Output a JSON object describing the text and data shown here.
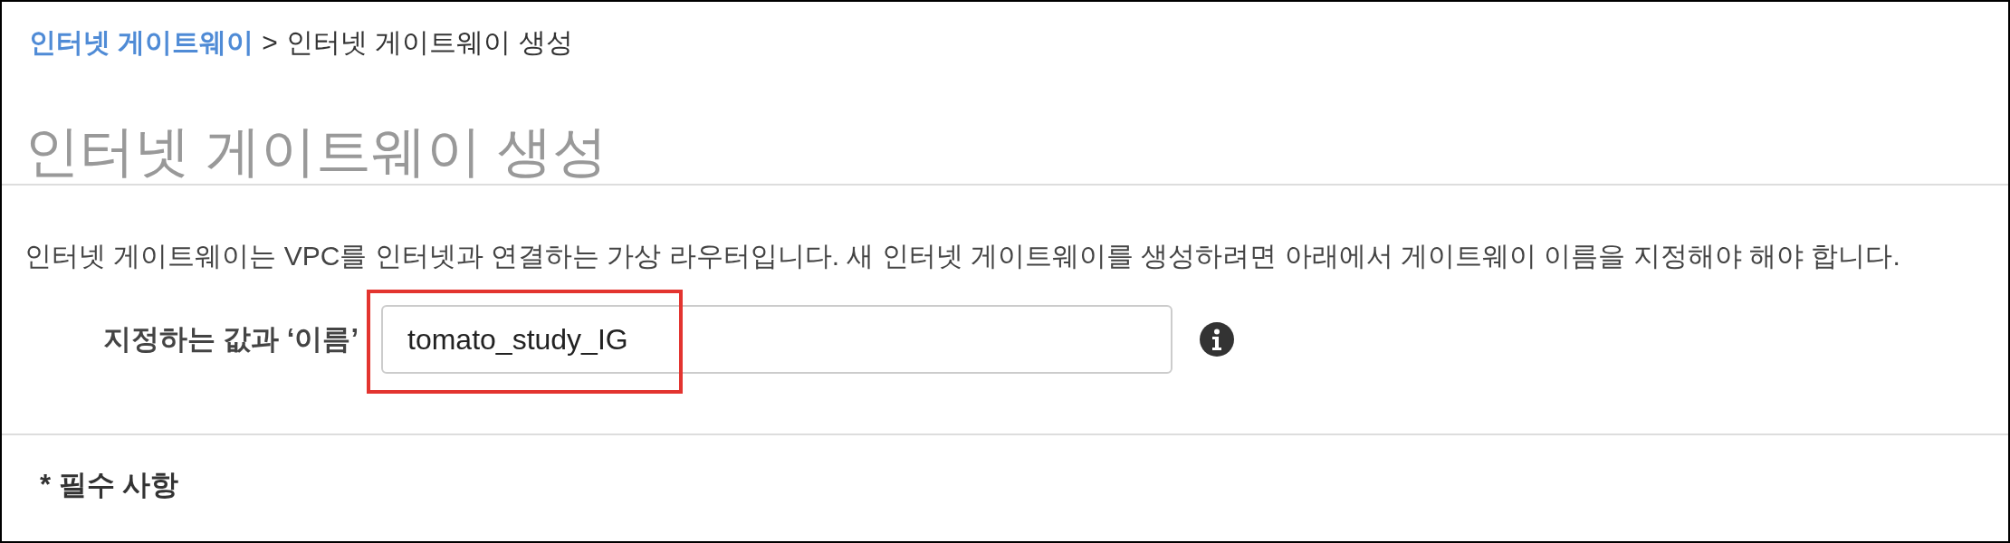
{
  "breadcrumb": {
    "separator": ">",
    "items": [
      {
        "label": "인터넷 게이트웨이",
        "kind": "link"
      },
      {
        "label": "인터넷 게이트웨이 생성",
        "kind": "current"
      }
    ]
  },
  "title": "인터넷 게이트웨이 생성",
  "description": "인터넷 게이트웨이는 VPC를 인터넷과 연결하는 가상 라우터입니다. 새 인터넷 게이트웨이를 생성하려면 아래에서 게이트웨이 이름을 지정해야 해야 합니다.",
  "form": {
    "fields": [
      {
        "label": "지정하는 값과 ‘이름’",
        "value": "tomato_study_IG",
        "highlighted": true,
        "info": true
      }
    ]
  },
  "footer": {
    "note": "* 필수 사항"
  }
}
